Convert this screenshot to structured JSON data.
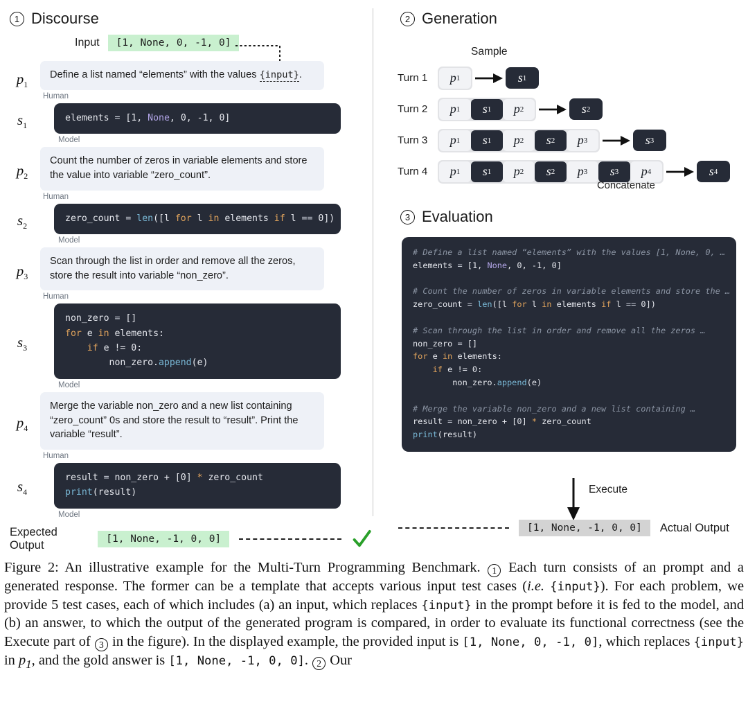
{
  "figure": {
    "label": "Figure 2",
    "sections": {
      "discourse": {
        "number": "1",
        "title": "Discourse"
      },
      "generation": {
        "number": "2",
        "title": "Generation"
      },
      "evaluation": {
        "number": "3",
        "title": "Evaluation"
      }
    }
  },
  "discourse": {
    "input_label": "Input",
    "input_value": "[1, None, 0, -1, 0]",
    "human_label": "Human",
    "model_label": "Model",
    "turns": [
      {
        "prompt_id": "p",
        "prompt_sub": "1",
        "prompt_text_before": "Define a list named “elements” with the values ",
        "prompt_placeholder": "{input}",
        "prompt_text_after": ".",
        "response_id": "s",
        "response_sub": "1",
        "response_code": "elements = [1, None, 0, -1, 0]"
      },
      {
        "prompt_id": "p",
        "prompt_sub": "2",
        "prompt_text_before": "Count the number of zeros in variable elements and store the value into variable “zero_count”.",
        "prompt_placeholder": "",
        "prompt_text_after": "",
        "response_id": "s",
        "response_sub": "2",
        "response_code": "zero_count = len([l for l in elements if l == 0])"
      },
      {
        "prompt_id": "p",
        "prompt_sub": "3",
        "prompt_text_before": "Scan through the list in order and remove all the zeros, store the result into variable “non_zero”.",
        "prompt_placeholder": "",
        "prompt_text_after": "",
        "response_id": "s",
        "response_sub": "3",
        "response_code": "non_zero = []\nfor e in elements:\n    if e != 0:\n        non_zero.append(e)"
      },
      {
        "prompt_id": "p",
        "prompt_sub": "4",
        "prompt_text_before": "Merge the variable non_zero and a new list containing “zero_count” 0s and store the result to “result”. Print the variable “result”.",
        "prompt_placeholder": "",
        "prompt_text_after": "",
        "response_id": "s",
        "response_sub": "4",
        "response_code": "result = non_zero + [0] * zero_count\nprint(result)"
      }
    ],
    "expected_output_label": "Expected Output",
    "expected_output_value": "[1, None, -1, 0, 0]",
    "match_icon": "green-check-icon"
  },
  "generation": {
    "sample_caption": "Sample",
    "concatenate_caption": "Concatenate",
    "rows": [
      {
        "turn_label": "Turn 1",
        "context": [
          {
            "t": "p",
            "n": "1"
          }
        ],
        "output": {
          "t": "s",
          "n": "1"
        }
      },
      {
        "turn_label": "Turn 2",
        "context": [
          {
            "t": "p",
            "n": "1"
          },
          {
            "t": "s",
            "n": "1"
          },
          {
            "t": "p",
            "n": "2"
          }
        ],
        "output": {
          "t": "s",
          "n": "2"
        }
      },
      {
        "turn_label": "Turn 3",
        "context": [
          {
            "t": "p",
            "n": "1"
          },
          {
            "t": "s",
            "n": "1"
          },
          {
            "t": "p",
            "n": "2"
          },
          {
            "t": "s",
            "n": "2"
          },
          {
            "t": "p",
            "n": "3"
          }
        ],
        "output": {
          "t": "s",
          "n": "3"
        }
      },
      {
        "turn_label": "Turn 4",
        "context": [
          {
            "t": "p",
            "n": "1"
          },
          {
            "t": "s",
            "n": "1"
          },
          {
            "t": "p",
            "n": "2"
          },
          {
            "t": "s",
            "n": "2"
          },
          {
            "t": "p",
            "n": "3"
          },
          {
            "t": "s",
            "n": "3"
          },
          {
            "t": "p",
            "n": "4"
          }
        ],
        "output": {
          "t": "s",
          "n": "4"
        }
      }
    ]
  },
  "evaluation": {
    "code_lines": [
      {
        "kind": "comment",
        "text": "# Define a list named “elements” with the values [1, None, 0, …"
      },
      {
        "kind": "code",
        "text": "elements = [1, None, 0, -1, 0]"
      },
      {
        "kind": "blank",
        "text": ""
      },
      {
        "kind": "comment",
        "text": "# Count the number of zeros in variable elements and store the …"
      },
      {
        "kind": "code",
        "text": "zero_count = len([l for l in elements if l == 0])"
      },
      {
        "kind": "blank",
        "text": ""
      },
      {
        "kind": "comment",
        "text": "# Scan through the list in order and remove all the zeros …"
      },
      {
        "kind": "code",
        "text": "non_zero = []"
      },
      {
        "kind": "code",
        "text": "for e in elements:"
      },
      {
        "kind": "code",
        "text": "    if e != 0:"
      },
      {
        "kind": "code",
        "text": "        non_zero.append(e)"
      },
      {
        "kind": "blank",
        "text": ""
      },
      {
        "kind": "comment",
        "text": "# Merge the variable non_zero and a new list containing …"
      },
      {
        "kind": "code",
        "text": "result = non_zero + [0] * zero_count"
      },
      {
        "kind": "code",
        "text": "print(result)"
      }
    ],
    "execute_caption": "Execute",
    "actual_output_value": "[1, None, -1, 0, 0]",
    "actual_output_label": "Actual Output"
  },
  "caption": {
    "p1": "Figure 2: An illustrative example for the Multi-Turn Programming Benchmark. ",
    "p2": " Each turn consists of an prompt and a generated response. The former can be a template that accepts various input test cases (",
    "ie": "i.e.",
    "p3": " ",
    "mono_input_1": "{input}",
    "p4": "). For each problem, we provide 5 test cases, each of which includes (a) an input, which replaces ",
    "mono_input_2": "{input}",
    "p5": " in the prompt before it is fed to the model, and (b) an answer, to which the output of the generated program is compared, in order to evaluate its functional correctness (see the Execute part of ",
    "p6": " in the figure). In the displayed example, the provided input is ",
    "mono_list_1": "[1, None, 0, -1, 0]",
    "p7": ", which replaces ",
    "mono_input_3": "{input}",
    "p8": " in ",
    "p_sym": "p",
    "p_sub": "1",
    "p9": ", and the gold answer is ",
    "mono_list_2": "[1, None, -1, 0, 0]",
    "p10": ". ",
    "p11": " Our"
  },
  "colors": {
    "prompt_bubble": "#eef1f7",
    "code_bubble": "#262b37",
    "input_highlight": "#c9f0cf",
    "output_highlight": "#d3d3d3",
    "keyword": "#e0a35c",
    "function": "#79b8d6",
    "constant": "#b3a6e8",
    "comment": "#8b94a3",
    "check_green": "#2aa02a"
  }
}
